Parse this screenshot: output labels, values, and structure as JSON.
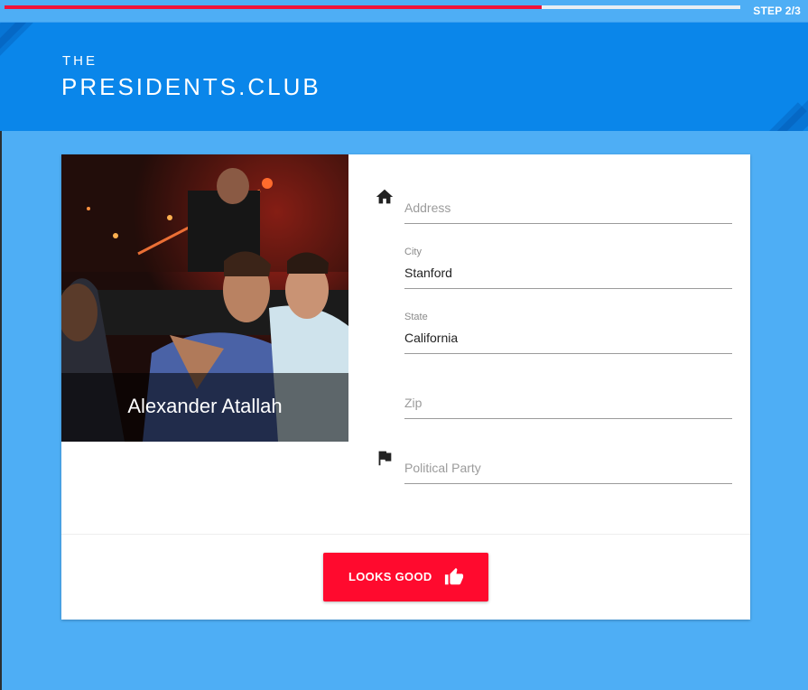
{
  "progress": {
    "step_label": "STEP 2/3",
    "fraction": 0.73
  },
  "brand": {
    "line1": "THE",
    "line2": "PRESIDENTS.CLUB"
  },
  "profile": {
    "name": "Alexander Atallah"
  },
  "form": {
    "address": {
      "placeholder": "Address",
      "icon": "home-icon"
    },
    "city": {
      "label": "City",
      "value": "Stanford"
    },
    "state": {
      "label": "State",
      "value": "California"
    },
    "zip": {
      "placeholder": "Zip"
    },
    "party": {
      "placeholder": "Political Party",
      "icon": "flag-icon"
    }
  },
  "submit": {
    "label": "LOOKS GOOD",
    "icon": "thumbs-up-icon"
  },
  "colors": {
    "background": "#4eaef5",
    "header": "#0a86ea",
    "progress": "#f0143a",
    "button": "#ff0a2e"
  }
}
